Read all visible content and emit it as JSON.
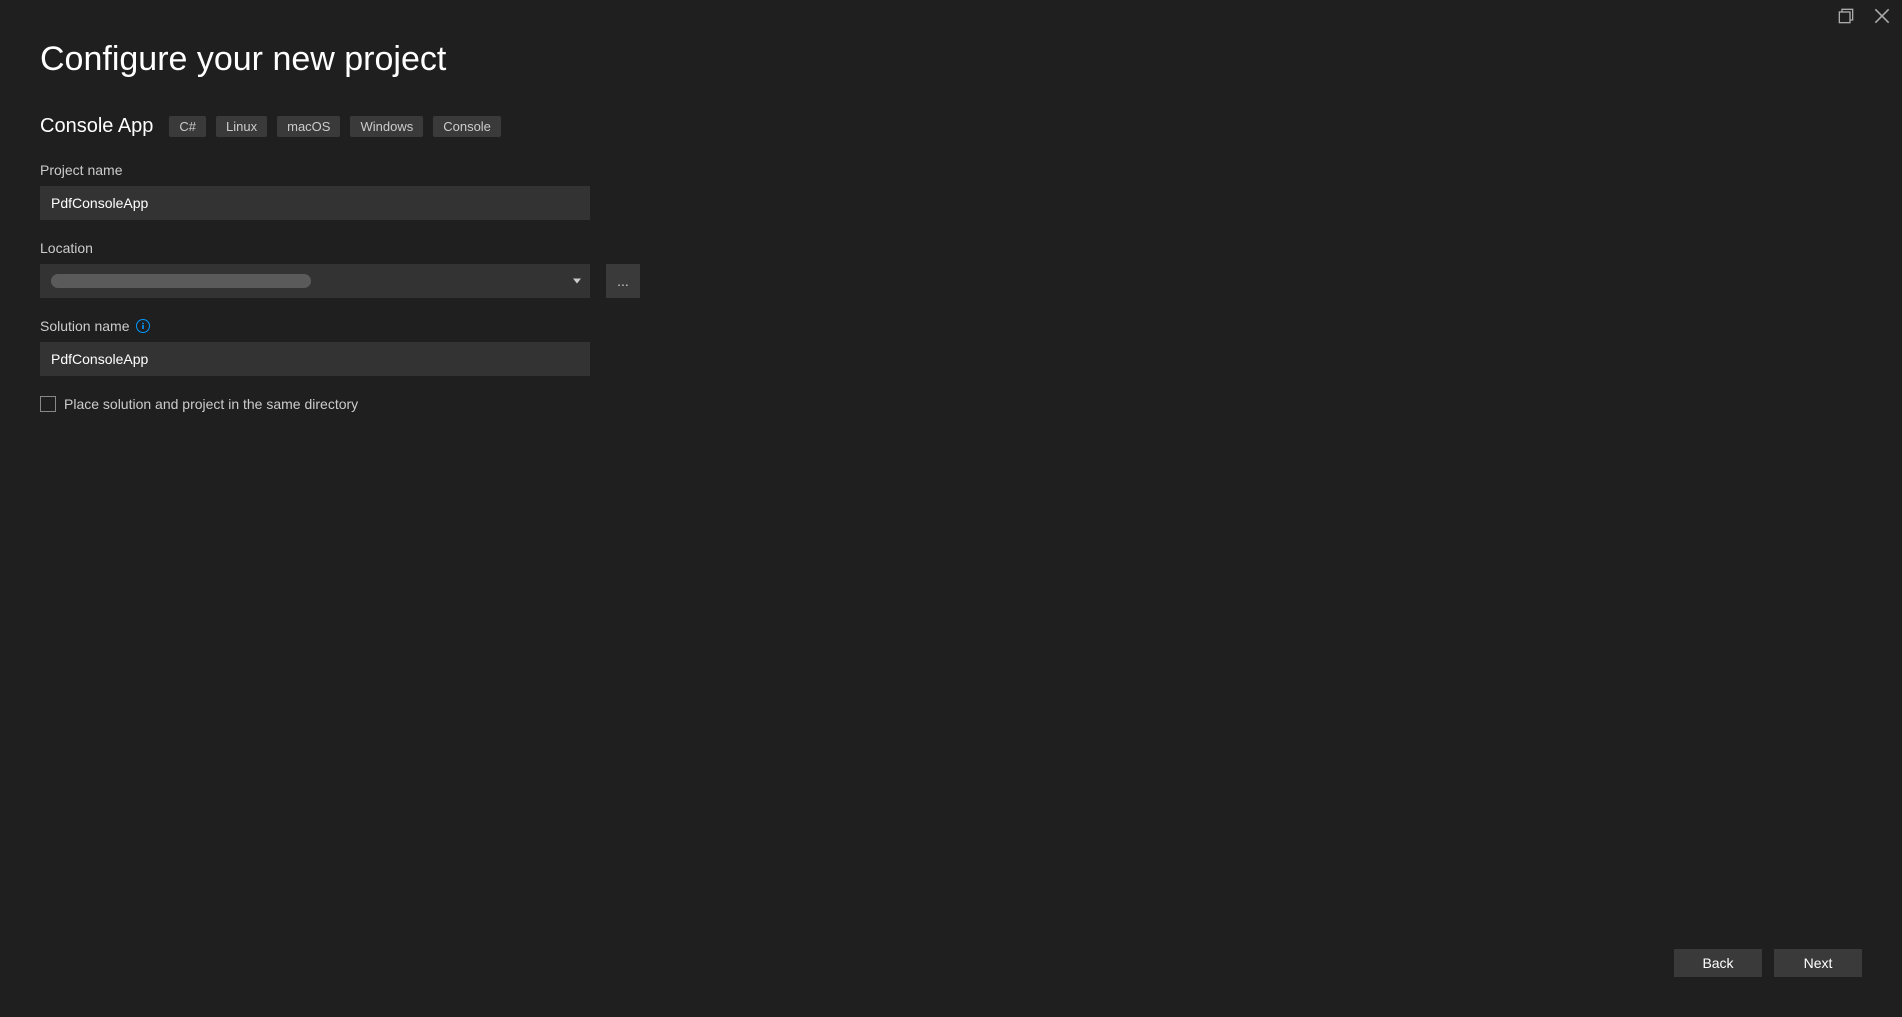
{
  "header": {
    "title": "Configure your new project",
    "template_name": "Console App",
    "tags": [
      "C#",
      "Linux",
      "macOS",
      "Windows",
      "Console"
    ]
  },
  "form": {
    "project_name_label": "Project name",
    "project_name_value": "PdfConsoleApp",
    "location_label": "Location",
    "location_value": "",
    "browse_label": "...",
    "solution_name_label": "Solution name",
    "solution_name_value": "PdfConsoleApp",
    "checkbox_label": "Place solution and project in the same directory",
    "checkbox_checked": false
  },
  "footer": {
    "back_label": "Back",
    "next_label": "Next"
  }
}
